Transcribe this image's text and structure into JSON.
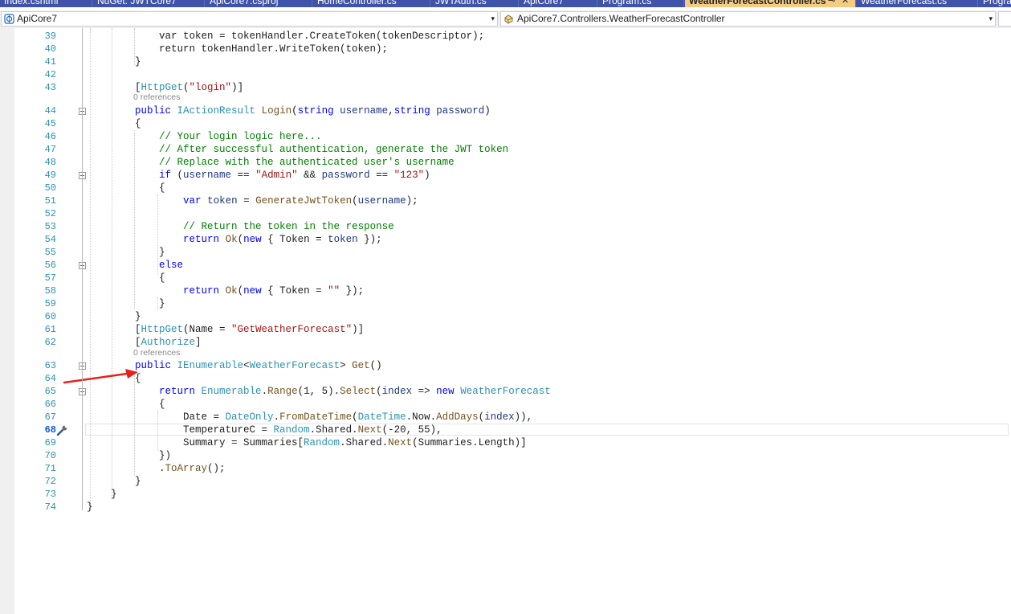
{
  "tabs": [
    {
      "label": "Index.cshtml",
      "active": false
    },
    {
      "label": "NuGet: JWTCore7",
      "active": false
    },
    {
      "label": "ApiCore7.csproj",
      "active": false
    },
    {
      "label": "HomeController.cs",
      "active": false
    },
    {
      "label": "JWTAuth.cs",
      "active": false
    },
    {
      "label": "ApiCore7",
      "active": false
    },
    {
      "label": "Program.cs",
      "active": false
    },
    {
      "label": "WeatherForecastController.cs",
      "active": true,
      "pin": "⊸",
      "close": "✕"
    },
    {
      "label": "WeatherForecast.cs",
      "active": false
    },
    {
      "label": "Progra",
      "active": false
    }
  ],
  "navbar": {
    "project": "ApiCore7",
    "class_scope": "ApiCore7.Controllers.WeatherForecastController",
    "arrow": "▾"
  },
  "editor": {
    "current_line": 68,
    "references_label": "0 references",
    "lines": [
      {
        "n": 39,
        "code": [
          [
            "",
            "            var token = tokenHandler.CreateToken(tokenDescriptor);"
          ]
        ]
      },
      {
        "n": 40,
        "code": [
          [
            "",
            "            return tokenHandler.WriteToken(token);"
          ]
        ]
      },
      {
        "n": 41,
        "code": [
          [
            "",
            "        }"
          ]
        ]
      },
      {
        "n": 42,
        "code": [
          [
            "",
            ""
          ]
        ]
      },
      {
        "n": 43,
        "code": [
          [
            "",
            "        ["
          ],
          [
            "ty",
            "HttpGet"
          ],
          [
            "",
            "("
          ],
          [
            "st",
            "\"login\""
          ],
          [
            "",
            ")]"
          ]
        ]
      },
      {
        "n": 44,
        "code": [
          [
            "",
            "        "
          ],
          [
            "kw",
            "public"
          ],
          [
            "",
            " "
          ],
          [
            "ty",
            "IActionResult"
          ],
          [
            "",
            " "
          ],
          [
            "mt",
            "Login"
          ],
          [
            "",
            "("
          ],
          [
            "kw",
            "string"
          ],
          [
            "",
            " "
          ],
          [
            "pm",
            "username"
          ],
          [
            "",
            ","
          ],
          [
            "kw",
            "string"
          ],
          [
            "",
            " "
          ],
          [
            "pm",
            "password"
          ],
          [
            "",
            ")"
          ]
        ]
      },
      {
        "n": 45,
        "code": [
          [
            "",
            "        {"
          ]
        ]
      },
      {
        "n": 46,
        "code": [
          [
            "",
            "            "
          ],
          [
            "cm",
            "// Your login logic here..."
          ]
        ]
      },
      {
        "n": 47,
        "code": [
          [
            "",
            "            "
          ],
          [
            "cm",
            "// After successful authentication, generate the JWT token"
          ]
        ]
      },
      {
        "n": 48,
        "code": [
          [
            "",
            "            "
          ],
          [
            "cm",
            "// Replace with the authenticated user's username"
          ]
        ]
      },
      {
        "n": 49,
        "code": [
          [
            "",
            "            "
          ],
          [
            "kw",
            "if"
          ],
          [
            "",
            " ("
          ],
          [
            "pm",
            "username"
          ],
          [
            "",
            " == "
          ],
          [
            "st",
            "\"Admin\""
          ],
          [
            "",
            " && "
          ],
          [
            "pm",
            "password"
          ],
          [
            "",
            " == "
          ],
          [
            "st",
            "\"123\""
          ],
          [
            "",
            ")"
          ]
        ]
      },
      {
        "n": 50,
        "code": [
          [
            "",
            "            {"
          ]
        ]
      },
      {
        "n": 51,
        "code": [
          [
            "",
            "                "
          ],
          [
            "kw",
            "var"
          ],
          [
            "",
            " "
          ],
          [
            "pm",
            "token"
          ],
          [
            "",
            " = "
          ],
          [
            "mt",
            "GenerateJwtToken"
          ],
          [
            "",
            "("
          ],
          [
            "pm",
            "username"
          ],
          [
            "",
            ");"
          ]
        ]
      },
      {
        "n": 52,
        "code": [
          [
            "",
            ""
          ]
        ]
      },
      {
        "n": 53,
        "code": [
          [
            "",
            "                "
          ],
          [
            "cm",
            "// Return the token in the response"
          ]
        ]
      },
      {
        "n": 54,
        "code": [
          [
            "",
            "                "
          ],
          [
            "kw",
            "return"
          ],
          [
            "",
            " "
          ],
          [
            "mt",
            "Ok"
          ],
          [
            "",
            "("
          ],
          [
            "kw",
            "new"
          ],
          [
            "",
            " { Token = "
          ],
          [
            "pm",
            "token"
          ],
          [
            "",
            " });"
          ]
        ]
      },
      {
        "n": 55,
        "code": [
          [
            "",
            "            }"
          ]
        ]
      },
      {
        "n": 56,
        "code": [
          [
            "",
            "            "
          ],
          [
            "kw",
            "else"
          ]
        ]
      },
      {
        "n": 57,
        "code": [
          [
            "",
            "            {"
          ]
        ]
      },
      {
        "n": 58,
        "code": [
          [
            "",
            "                "
          ],
          [
            "kw",
            "return"
          ],
          [
            "",
            " "
          ],
          [
            "mt",
            "Ok"
          ],
          [
            "",
            "("
          ],
          [
            "kw",
            "new"
          ],
          [
            "",
            " { Token = "
          ],
          [
            "st",
            "\"\""
          ],
          [
            "",
            " });"
          ]
        ]
      },
      {
        "n": 59,
        "code": [
          [
            "",
            "            }"
          ]
        ]
      },
      {
        "n": 60,
        "code": [
          [
            "",
            "        }"
          ]
        ]
      },
      {
        "n": 61,
        "code": [
          [
            "",
            "        ["
          ],
          [
            "ty",
            "HttpGet"
          ],
          [
            "",
            "(Name = "
          ],
          [
            "st",
            "\"GetWeatherForecast\""
          ],
          [
            "",
            ")]"
          ]
        ]
      },
      {
        "n": 62,
        "code": [
          [
            "",
            "        ["
          ],
          [
            "ty",
            "Authorize"
          ],
          [
            "",
            "]"
          ]
        ]
      },
      {
        "n": 63,
        "code": [
          [
            "",
            "        "
          ],
          [
            "kw",
            "public"
          ],
          [
            "",
            " "
          ],
          [
            "ty",
            "IEnumerable"
          ],
          [
            "",
            "<"
          ],
          [
            "ty",
            "WeatherForecast"
          ],
          [
            "",
            "> "
          ],
          [
            "mt",
            "Get"
          ],
          [
            "",
            "()"
          ]
        ]
      },
      {
        "n": 64,
        "code": [
          [
            "",
            "        {"
          ]
        ]
      },
      {
        "n": 65,
        "code": [
          [
            "",
            "            "
          ],
          [
            "kw",
            "return"
          ],
          [
            "",
            " "
          ],
          [
            "ty",
            "Enumerable"
          ],
          [
            "",
            "."
          ],
          [
            "mt",
            "Range"
          ],
          [
            "",
            "(1, 5)."
          ],
          [
            "mt",
            "Select"
          ],
          [
            "",
            "("
          ],
          [
            "pm",
            "index"
          ],
          [
            "",
            " => "
          ],
          [
            "kw",
            "new"
          ],
          [
            "",
            " "
          ],
          [
            "ty",
            "WeatherForecast"
          ]
        ]
      },
      {
        "n": 66,
        "code": [
          [
            "",
            "            {"
          ]
        ]
      },
      {
        "n": 67,
        "code": [
          [
            "",
            "                Date = "
          ],
          [
            "ty",
            "DateOnly"
          ],
          [
            "",
            "."
          ],
          [
            "mt",
            "FromDateTime"
          ],
          [
            "",
            "("
          ],
          [
            "ty",
            "DateTime"
          ],
          [
            "",
            ".Now."
          ],
          [
            "mt",
            "AddDays"
          ],
          [
            "",
            "("
          ],
          [
            "pm",
            "index"
          ],
          [
            "",
            ")),"
          ]
        ]
      },
      {
        "n": 68,
        "code": [
          [
            "",
            "                TemperatureC = "
          ],
          [
            "ty",
            "Random"
          ],
          [
            "",
            ".Shared."
          ],
          [
            "mt",
            "Next"
          ],
          [
            "",
            "(-20, 55),"
          ]
        ]
      },
      {
        "n": 69,
        "code": [
          [
            "",
            "                Summary = Summaries["
          ],
          [
            "ty",
            "Random"
          ],
          [
            "",
            ".Shared."
          ],
          [
            "mt",
            "Next"
          ],
          [
            "",
            "(Summaries.Length)]"
          ]
        ]
      },
      {
        "n": 70,
        "code": [
          [
            "",
            "            })"
          ]
        ]
      },
      {
        "n": 71,
        "code": [
          [
            "",
            "            ."
          ],
          [
            "mt",
            "ToArray"
          ],
          [
            "",
            "();"
          ]
        ]
      },
      {
        "n": 72,
        "code": [
          [
            "",
            "        }"
          ]
        ]
      },
      {
        "n": 73,
        "code": [
          [
            "",
            "    }"
          ]
        ]
      },
      {
        "n": 74,
        "code": [
          [
            "",
            "}"
          ]
        ]
      }
    ]
  },
  "colors": {
    "keyword": "#0000ff",
    "type": "#2b91af",
    "string": "#a31515",
    "comment": "#008000",
    "method": "#74531f",
    "parameter": "#1f377f",
    "annotation_arrow": "#e8221b",
    "active_tab": "#f5cc84"
  },
  "icons": {
    "project_dropdown": "csharp-project-icon",
    "scope_dropdown": "class-icon",
    "gutter": "screwdriver-quick-action-icon"
  }
}
